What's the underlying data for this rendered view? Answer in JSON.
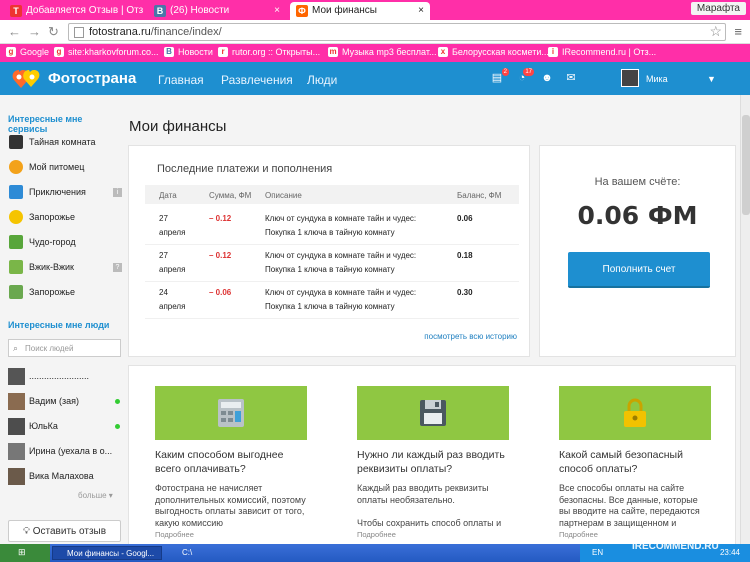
{
  "browser": {
    "tabs": [
      {
        "label": "Добавляется Отзыв | Отз",
        "icon": "T",
        "color": "#e33",
        "active": false
      },
      {
        "label": "(26) Новости",
        "icon": "B",
        "color": "#4a76a8",
        "active": false
      },
      {
        "label": "Мои финансы",
        "icon": "Ф",
        "color": "#f60",
        "active": true
      }
    ],
    "profile_name": "Марафта",
    "url_host": "fotostrana.ru",
    "url_path": "/finance/index/",
    "bookmarks": [
      {
        "label": "Google",
        "icon": "g"
      },
      {
        "label": "site:kharkovforum.co...",
        "icon": "g"
      },
      {
        "label": "Новости",
        "icon": "B"
      },
      {
        "label": "rutor.org :: Открыты...",
        "icon": "r"
      },
      {
        "label": "Музыка mp3 бесплат...",
        "icon": "m"
      },
      {
        "label": "Белорусская космети...",
        "icon": "x"
      },
      {
        "label": "IRecommend.ru | Отз...",
        "icon": "i"
      }
    ]
  },
  "site": {
    "logo_text": "Фотострана",
    "nav": [
      "Главная",
      "Развлечения",
      "Люди"
    ],
    "badges": {
      "messages": "2",
      "events": "17"
    },
    "user_name": "Мика"
  },
  "sidebar": {
    "services_heading": "Интересные мне сервисы",
    "services": [
      {
        "label": "Тайная комната",
        "color": "#333",
        "tag": ""
      },
      {
        "label": "Мой питомец",
        "color": "#f3a21a",
        "tag": ""
      },
      {
        "label": "Приключения",
        "color": "#2e8bd6",
        "tag": "i"
      },
      {
        "label": "Запорожье",
        "color": "#f5c400",
        "tag": ""
      },
      {
        "label": "Чудо-город",
        "color": "#58a63b",
        "tag": ""
      },
      {
        "label": "Вжик-Вжик",
        "color": "#7ab648",
        "tag": "?"
      },
      {
        "label": "Запорожье",
        "color": "#6aa84f",
        "tag": ""
      }
    ],
    "people_heading": "Интересные мне люди",
    "search_placeholder": "Поиск людей",
    "people": [
      {
        "name": "........................",
        "online": false
      },
      {
        "name": "Вадим (зая)",
        "online": true
      },
      {
        "name": "ЮльКа",
        "online": true
      },
      {
        "name": "Ирина (уехала в о...",
        "online": false
      },
      {
        "name": "Вика Малахова",
        "online": false
      }
    ],
    "more_label": "больше ▾",
    "feedback_label": "Оставить отзыв"
  },
  "main": {
    "page_title": "Мои финансы",
    "payments": {
      "title": "Последние платежи и пополнения",
      "columns": [
        "Дата",
        "Сумма, ФМ",
        "Описание",
        "Баланс, ФМ"
      ],
      "rows": [
        {
          "day": "27",
          "month": "апреля",
          "amount": "– 0.12",
          "desc1": "Ключ от сундука в комнате тайн и чудес:",
          "desc2": "Покупка 1 ключа в тайную комнату",
          "balance": "0.06"
        },
        {
          "day": "27",
          "month": "апреля",
          "amount": "– 0.12",
          "desc1": "Ключ от сундука в комнате тайн и чудес:",
          "desc2": "Покупка 1 ключа в тайную комнату",
          "balance": "0.18"
        },
        {
          "day": "24",
          "month": "апреля",
          "amount": "– 0.06",
          "desc1": "Ключ от сундука в комнате тайн и чудес:",
          "desc2": "Покупка 1 ключа в тайную комнату",
          "balance": "0.30"
        }
      ],
      "history_link": "посмотреть всю историю"
    },
    "balance": {
      "label": "На вашем счёте:",
      "amount": "0.06 ФМ",
      "topup_label": "Пополнить счет"
    },
    "info_blocks": [
      {
        "icon": "calculator-icon",
        "title": "Каким способом выгоднее всего оплачивать?",
        "text": "Фотострана не начисляет дополнительных комиссий, поэтому выгодность оплаты зависит от того, какую комиссию",
        "more": "Подробнее"
      },
      {
        "icon": "floppy-icon",
        "title": "Нужно ли каждый раз вводить реквизиты оплаты?",
        "text": "Каждый раз вводить реквизиты оплаты необязательно.\n\nЧтобы сохранить способ оплаты и",
        "more": "Подробнее"
      },
      {
        "icon": "lock-icon",
        "title": "Какой самый безопасный способ оплаты?",
        "text": "Все способы оплаты на сайте безопасны. Все данные, которые вы вводите на сайте, передаются партнерам в защищенном и",
        "more": "Подробнее"
      }
    ]
  },
  "taskbar": {
    "tasks": [
      "Мои финансы - Googl...",
      "C:\\"
    ],
    "lang": "EN",
    "clock": "23:44"
  },
  "watermark": "IRECOMMEND.RU",
  "colors": {
    "brand": "#1e8fd0",
    "browser_accent": "#ff2fa8",
    "info_green": "#8fc742",
    "negative": "#d33"
  }
}
